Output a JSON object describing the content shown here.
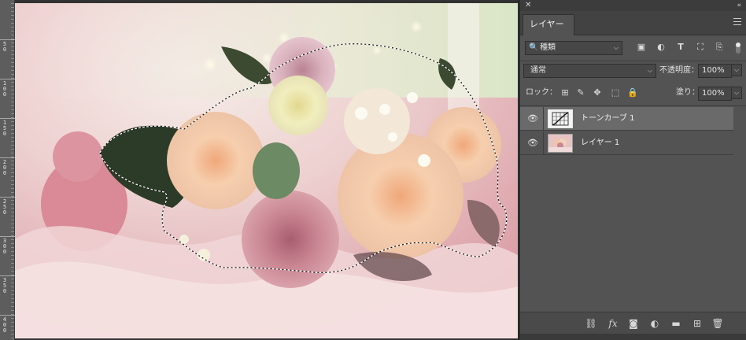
{
  "ruler": {
    "labels": [
      "50",
      "100",
      "150",
      "200",
      "250",
      "300",
      "350",
      "400"
    ]
  },
  "canvas": {
    "description_icon": "image-canvas"
  },
  "panel": {
    "tab_label": "レイヤー",
    "filter": {
      "search_icon": "magnifier-icon",
      "value": "種類"
    },
    "blend_mode": "通常",
    "opacity_label": "不透明度：",
    "opacity_value": "100%",
    "lock_label": "ロック：",
    "fill_label": "塗り：",
    "fill_value": "100%",
    "layers": [
      {
        "name": "トーンカーブ 1",
        "selected": true,
        "type": "adjustment"
      },
      {
        "name": "レイヤー 1",
        "selected": false,
        "type": "pixel"
      }
    ]
  },
  "colors": {
    "panel_bg": "#535353",
    "selected_row": "#6a6a6a",
    "canvas_pink": "#e8c7c3"
  }
}
